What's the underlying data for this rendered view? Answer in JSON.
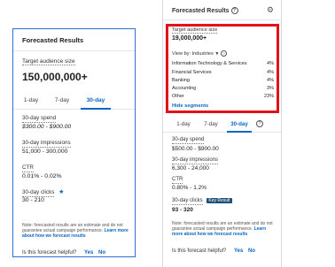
{
  "left_panel": {
    "title": "Forecasted Results",
    "target_label": "Target audience size",
    "target_value": "150,000,000+",
    "tabs": [
      "1-day",
      "7-day",
      "30-day"
    ],
    "metrics": [
      {
        "label": "30-day spend",
        "value": "$300.00 - $900.00"
      },
      {
        "label": "30-day impressions",
        "value": "51,000 - 300,000"
      },
      {
        "label": "CTR",
        "value": "0.01% - 0.02%"
      },
      {
        "label": "30-day clicks",
        "value": "30 - 210"
      }
    ],
    "note": "Note: forecasted results are an estimate and do not guarantee actual campaign performance.",
    "note_link": "Learn more about how we forecast results",
    "helpful_question": "Is this forecast helpful?",
    "yes": "Yes",
    "no": "No"
  },
  "right_panel": {
    "title": "Forecasted Results",
    "target_label": "Target audience size",
    "target_value": "19,000,000+",
    "view_by_label": "View by: Industries",
    "segments": [
      {
        "label": "Information Technology & Services",
        "value": "4%"
      },
      {
        "label": "Financial Services",
        "value": "4%"
      },
      {
        "label": "Banking",
        "value": "4%"
      },
      {
        "label": "Accounting",
        "value": "3%"
      },
      {
        "label": "Other",
        "value": "23%"
      }
    ],
    "hide_segments": "Hide segments",
    "tabs": [
      "1-day",
      "7-day",
      "30-day"
    ],
    "metrics": [
      {
        "label": "30-day spend",
        "value": "$500.00 - $900.00"
      },
      {
        "label": "30-day impressions",
        "value": "6,300 - 24,000"
      },
      {
        "label": "CTR",
        "value": "0.80% - 1.2%"
      },
      {
        "label": "30-day clicks",
        "value": "93 - 320",
        "badge": "Key Result"
      }
    ],
    "note": "Note: forecasted results are an estimate and do not guarantee actual campaign performance.",
    "note_link": "Learn more about how we forecast results",
    "helpful_question": "Is this forecast helpful?",
    "yes": "Yes",
    "no": "No"
  },
  "icons": {
    "help": "question-circle-icon",
    "settings": "gear-icon",
    "key_result": "star-icon",
    "dropdown": "caret-down-icon"
  },
  "colors": {
    "link": "#0a66c2",
    "highlight": "#e3121a",
    "badge": "#1d4f79"
  }
}
